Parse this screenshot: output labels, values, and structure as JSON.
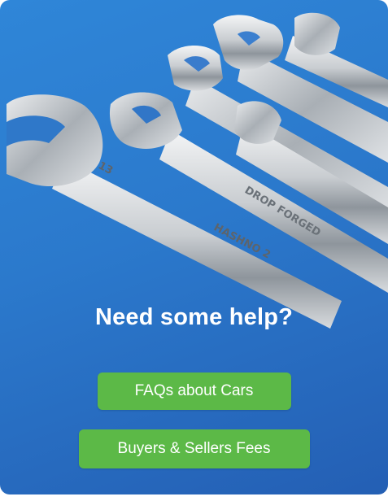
{
  "help_card": {
    "headline": "Need some help?",
    "faq_button_label": "FAQs about Cars",
    "fees_button_label": "Buyers & Sellers Fees",
    "colors": {
      "background_top": "#2f86d8",
      "background_bottom": "#245fb4",
      "button_green": "#5cb947",
      "text": "#ffffff"
    },
    "image": {
      "icon": "wrenches-image"
    }
  }
}
